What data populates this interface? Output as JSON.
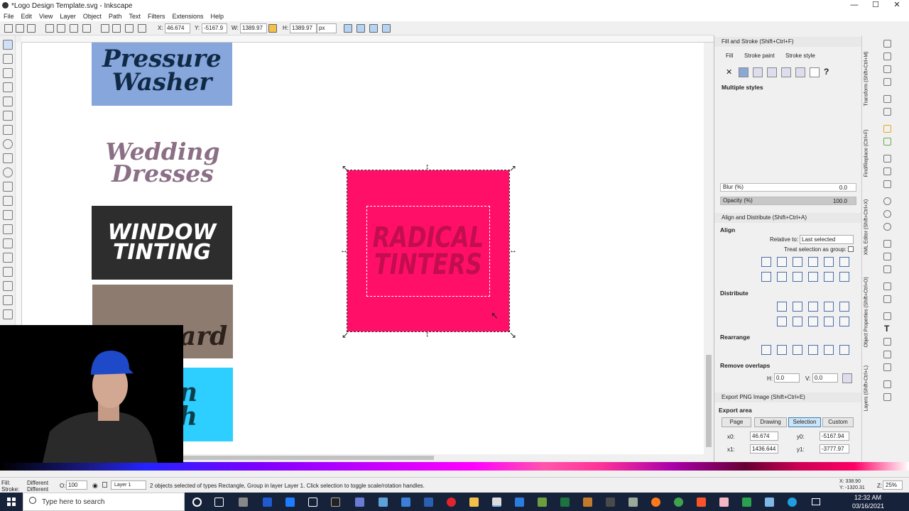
{
  "window": {
    "title": "*Logo Design Template.svg - Inkscape",
    "min": "—",
    "max": "☐",
    "close": "✕"
  },
  "menu": [
    "File",
    "Edit",
    "View",
    "Layer",
    "Object",
    "Path",
    "Text",
    "Filters",
    "Extensions",
    "Help"
  ],
  "toolbar": {
    "x_label": "X:",
    "x_value": "46.674",
    "y_label": "Y:",
    "y_value": "-5167.9",
    "w_label": "W:",
    "w_value": "1389.97",
    "h_label": "H:",
    "h_value": "1389.97",
    "unit": "px"
  },
  "canvas": {
    "logos": [
      {
        "text": "Pressure\nWasher",
        "bg": "#86a6dc",
        "fg": "#102a45"
      },
      {
        "text": "Wedding\nDresses",
        "bg": "#ffffff",
        "fg": "#8b6f86"
      },
      {
        "text": "WINDOW\nTINTING",
        "bg": "#2d2d2d",
        "fg": "#ffffff"
      },
      {
        "text": "Junkyard",
        "bg": "#8e7b70",
        "fg": "#2c211b"
      },
      {
        "text": "n\nh",
        "bg": "#2ccfff",
        "fg": "#0f3d4a"
      }
    ],
    "selected": {
      "text": "RADICAL\nTINTERS",
      "bg": "#ff0f68",
      "fg": "#c20d4f"
    }
  },
  "fill_stroke": {
    "header": "Fill and Stroke (Shift+Ctrl+F)",
    "tabs": [
      "Fill",
      "Stroke paint",
      "Stroke style"
    ],
    "status": "Multiple styles",
    "blur_label": "Blur (%)",
    "blur_value": "0.0",
    "opacity_label": "Opacity (%)",
    "opacity_value": "100.0",
    "opacity_level": 100
  },
  "align": {
    "header": "Align and Distribute (Shift+Ctrl+A)",
    "align_title": "Align",
    "relative_label": "Relative to:",
    "relative_value": "Last selected",
    "group_label": "Treat selection as group:",
    "distribute_title": "Distribute",
    "rearrange_title": "Rearrange",
    "overlaps_title": "Remove overlaps",
    "h_label": "H:",
    "h_value": "0.0",
    "v_label": "V:",
    "v_value": "0.0"
  },
  "export": {
    "header": "Export PNG Image (Shift+Ctrl+E)",
    "area_title": "Export area",
    "buttons": [
      "Page",
      "Drawing",
      "Selection",
      "Custom"
    ],
    "active": "Selection",
    "x0_label": "x0:",
    "x0_value": "46.674",
    "y0_label": "y0:",
    "y0_value": "-5167.94",
    "x1_label": "x1:",
    "x1_value": "1436.644",
    "y1_label": "y1:",
    "y1_value": "-3777.97"
  },
  "vertical_tabs": [
    "Transform (Shift+Ctrl+M)",
    "Find/Replace (Ctrl+F)",
    "XML Editor (Shift+Ctrl+X)",
    "Object Properties (Shift+Ctrl+O)",
    "Layers (Shift+Ctrl+L)"
  ],
  "status": {
    "fill_label": "Fill:",
    "fill_value": "Different",
    "stroke_label": "Stroke:",
    "stroke_value": "Different",
    "opacity_label": "O:",
    "opacity_value": "100",
    "layer": "Layer 1",
    "message": "2 objects selected of types Rectangle, Group in layer Layer 1. Click selection to toggle scale/rotation handles.",
    "x_readout": "X: 338.90",
    "y_readout": "Y: -1320.31",
    "zoom_label": "Z:",
    "zoom_value": "25%"
  },
  "taskbar": {
    "search_placeholder": "Type here to search",
    "time": "12:32 AM",
    "date": "03/16/2021"
  }
}
